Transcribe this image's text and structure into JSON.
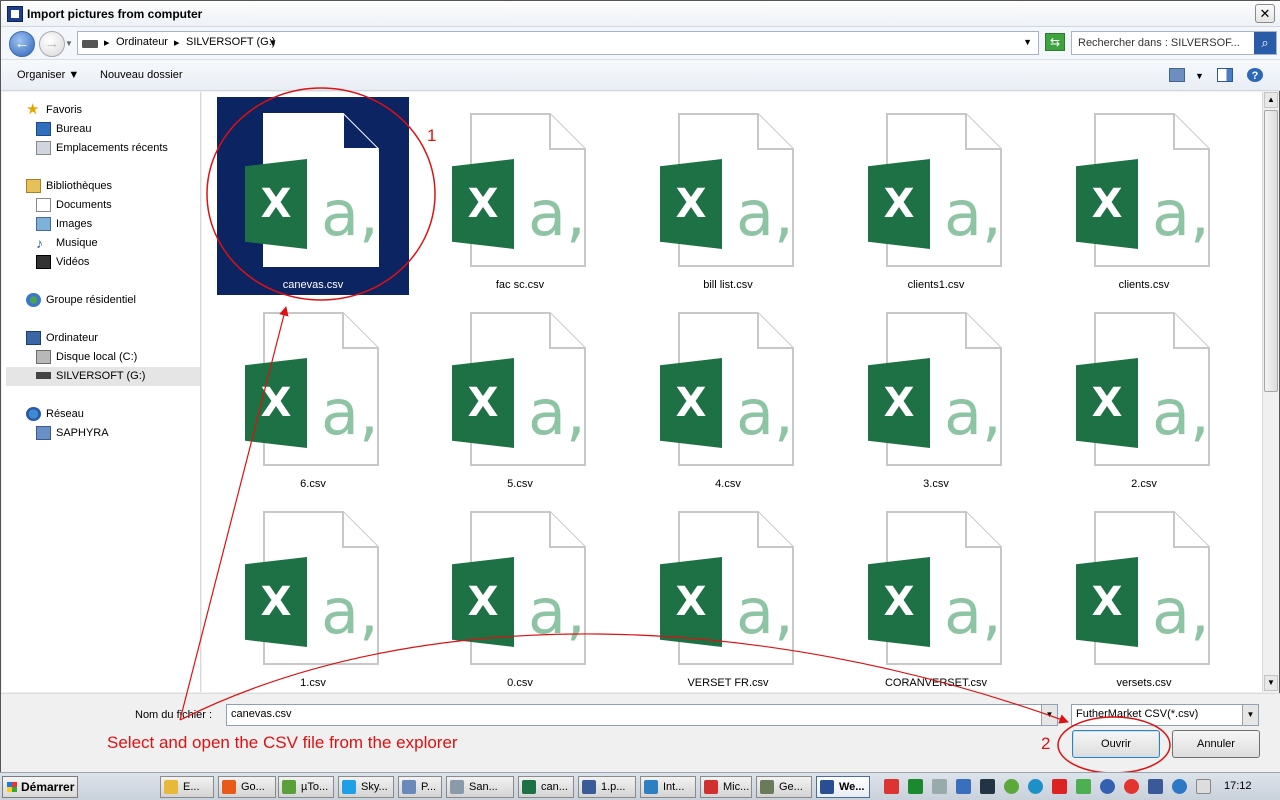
{
  "window": {
    "title": "Import pictures from computer",
    "close_glyph": "✕"
  },
  "address": {
    "crumbs": [
      "Ordinateur",
      "SILVERSOFT (G:)"
    ],
    "search_placeholder": "Rechercher dans : SILVERSOF..."
  },
  "toolbar": {
    "organize": "Organiser",
    "new_folder": "Nouveau dossier",
    "help": "?"
  },
  "nav": {
    "favorites": "Favoris",
    "bureau": "Bureau",
    "recent": "Emplacements récents",
    "libraries": "Bibliothèques",
    "documents": "Documents",
    "images": "Images",
    "music": "Musique",
    "videos": "Vidéos",
    "homegroup": "Groupe résidentiel",
    "computer": "Ordinateur",
    "local_disk": "Disque local (C:)",
    "usb": "SILVERSOFT (G:)",
    "network": "Réseau",
    "network_pc": "SAPHYRA"
  },
  "files": [
    {
      "name": "canevas.csv",
      "selected": true
    },
    {
      "name": "fac sc.csv"
    },
    {
      "name": "bill list.csv"
    },
    {
      "name": "clients1.csv"
    },
    {
      "name": "clients.csv"
    },
    {
      "name": "6.csv"
    },
    {
      "name": "5.csv"
    },
    {
      "name": "4.csv"
    },
    {
      "name": "3.csv"
    },
    {
      "name": "2.csv"
    },
    {
      "name": "1.csv"
    },
    {
      "name": "0.csv"
    },
    {
      "name": "VERSET FR.csv"
    },
    {
      "name": "CORANVERSET.csv"
    },
    {
      "name": "versets.csv"
    }
  ],
  "file_icon": {
    "excel_letter": "X",
    "csv_letter": "a,"
  },
  "bottom": {
    "filename_label": "Nom du fichier :",
    "filename_value": "canevas.csv",
    "filter": "FutherMarket CSV(*.csv)",
    "open": "Ouvrir",
    "cancel": "Annuler"
  },
  "annotations": {
    "step1": "1",
    "step2": "2",
    "instruction": "Select and open the CSV file from the explorer"
  },
  "taskbar": {
    "start": "Démarrer",
    "items": [
      "E...",
      "Go...",
      "µTo...",
      "Sky...",
      "P...",
      "San...",
      "can...",
      "1.p...",
      "Int...",
      "Mic...",
      "Ge...",
      "We..."
    ],
    "clock": "17:12"
  },
  "colors": {
    "selection": "#0c2461",
    "excel_green": "#1d7145",
    "annotation_red": "#d11111"
  }
}
